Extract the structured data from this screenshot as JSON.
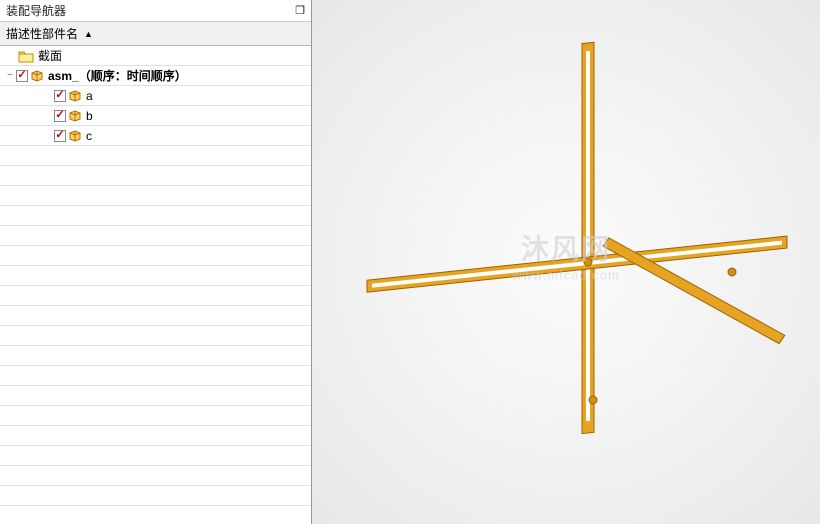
{
  "panel": {
    "title": "装配导航器",
    "column_header": "描述性部件名"
  },
  "tree": {
    "root_section": "截面",
    "assembly": {
      "label": "asm_（顺序：时间顺序）",
      "checked": true
    },
    "parts": [
      {
        "label": "a",
        "checked": true
      },
      {
        "label": "b",
        "checked": true
      },
      {
        "label": "c",
        "checked": true
      }
    ]
  },
  "watermark": {
    "line1": "沐风网",
    "line2": "www.mfcad.com"
  },
  "icons": {
    "window": "❐",
    "arrow_up": "▲",
    "expander_minus": "−"
  }
}
